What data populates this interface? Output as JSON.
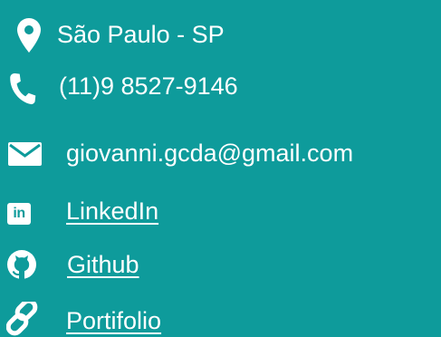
{
  "contact": {
    "items": [
      {
        "icon": "location-pin-icon",
        "text": "São Paulo - SP"
      },
      {
        "icon": "phone-icon",
        "text": "(11)9 8527-9146"
      },
      {
        "icon": "envelope-icon",
        "text": "giovanni.gcda@gmail.com"
      },
      {
        "icon": "linkedin-icon",
        "text": "LinkedIn",
        "icon_text": "in"
      },
      {
        "icon": "github-icon",
        "text": "Github"
      },
      {
        "icon": "chain-link-icon",
        "text": "Portifolio"
      }
    ]
  },
  "colors": {
    "background": "#0e9b9b",
    "foreground": "#ffffff"
  }
}
